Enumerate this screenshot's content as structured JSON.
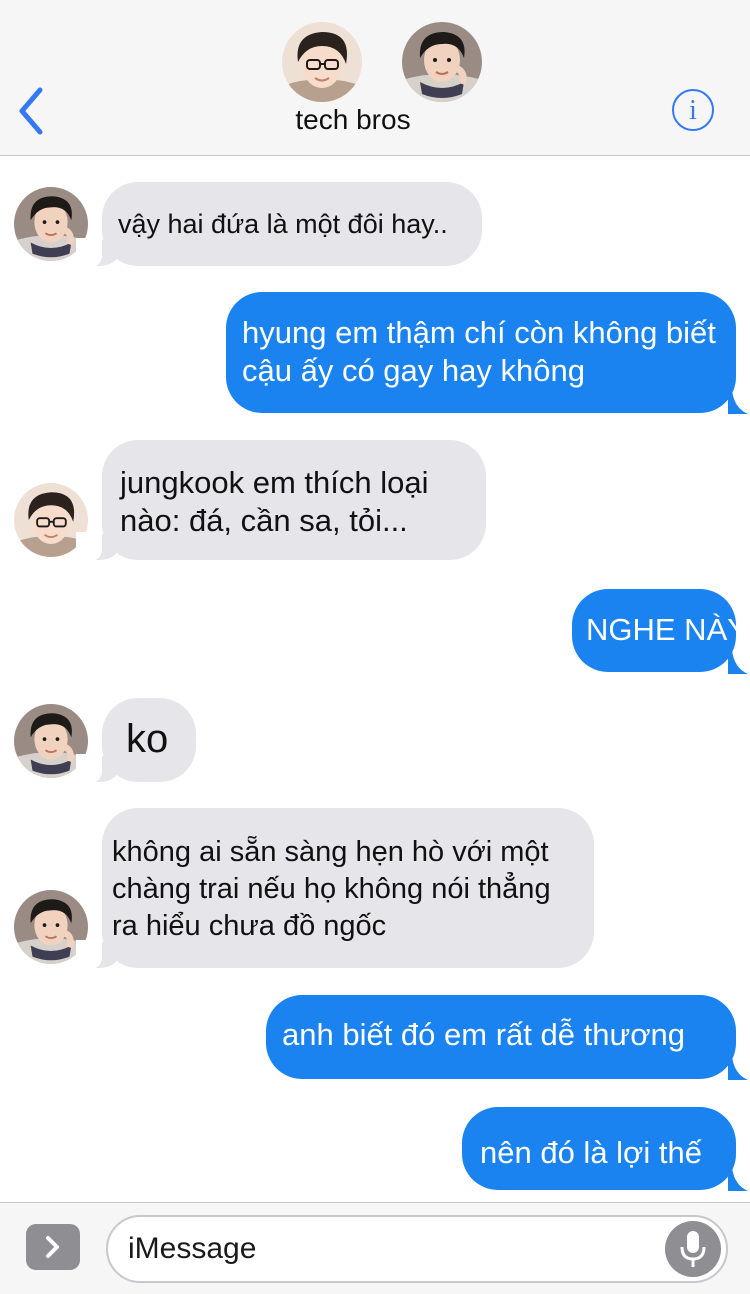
{
  "header": {
    "title": "tech bros",
    "back_icon": "chevron-left-icon",
    "info_icon": "info-icon",
    "info_glyph": "i"
  },
  "messages": [
    {
      "side": "in",
      "sender": "glasses",
      "text": "vậy hai đứa là một đôi hay.."
    },
    {
      "side": "out",
      "text": "hyung em thậm chí còn không biết cậu ấy có gay hay không"
    },
    {
      "side": "in",
      "sender": "glasses",
      "text": "jungkook em thích loại nào: đá, cần sa, tỏi..."
    },
    {
      "side": "out",
      "text": "NGHE NÀY"
    },
    {
      "side": "in",
      "sender": "scarf",
      "text": "ko"
    },
    {
      "side": "in",
      "sender": "scarf",
      "text": "không ai sẵn sàng hẹn hò với một chàng trai nếu họ không nói thẳng ra hiểu chưa đồ ngốc"
    },
    {
      "side": "out",
      "text": "anh biết đó em rất dễ thương"
    },
    {
      "side": "out",
      "text": "nên đó là lợi thế"
    }
  ],
  "composer": {
    "placeholder": "iMessage",
    "expand_icon": "chevron-right-icon",
    "mic_icon": "microphone-icon"
  },
  "colors": {
    "outgoing_bubble": "#1a83f0",
    "incoming_bubble": "#e5e5ea",
    "accent": "#3478f6",
    "header_bg": "#f6f6f6"
  }
}
